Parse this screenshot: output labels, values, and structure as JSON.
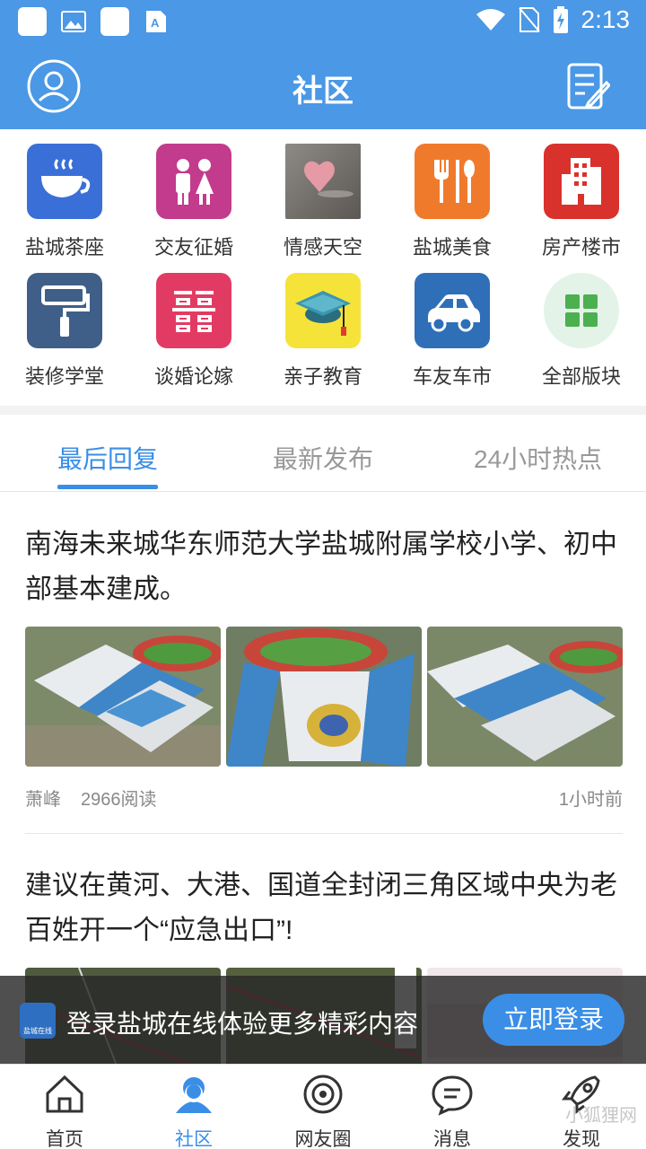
{
  "status_bar": {
    "time": "2:13"
  },
  "header": {
    "title": "社区"
  },
  "categories": [
    {
      "label": "盐城茶座",
      "icon": "tea-cup-icon"
    },
    {
      "label": "交友征婚",
      "icon": "couple-icon"
    },
    {
      "label": "情感天空",
      "icon": "heart-photo-icon"
    },
    {
      "label": "盐城美食",
      "icon": "cutlery-icon"
    },
    {
      "label": "房产楼市",
      "icon": "building-icon"
    },
    {
      "label": "装修学堂",
      "icon": "paint-roller-icon"
    },
    {
      "label": "谈婚论嫁",
      "icon": "double-happiness-icon"
    },
    {
      "label": "亲子教育",
      "icon": "graduation-cap-icon"
    },
    {
      "label": "车友车市",
      "icon": "car-icon"
    },
    {
      "label": "全部版块",
      "icon": "grid-icon"
    }
  ],
  "tabs": [
    {
      "label": "最后回复",
      "active": true
    },
    {
      "label": "最新发布",
      "active": false
    },
    {
      "label": "24小时热点",
      "active": false
    }
  ],
  "posts": [
    {
      "title": "南海未来城华东师范大学盐城附属学校小学、初中部基本建成。",
      "author": "萧峰",
      "reads": "2966阅读",
      "time": "1小时前"
    },
    {
      "title": "建议在黄河、大港、国道全封闭三角区域中央为老百姓开一个“应急出口”!"
    }
  ],
  "login_banner": {
    "logo_text": "盐城在线",
    "text": "登录盐城在线体验更多精彩内容",
    "button": "立即登录"
  },
  "bottom_nav": [
    {
      "label": "首页",
      "icon": "home-icon"
    },
    {
      "label": "社区",
      "icon": "community-icon",
      "active": true
    },
    {
      "label": "网友圈",
      "icon": "circle-icon"
    },
    {
      "label": "消息",
      "icon": "message-icon"
    },
    {
      "label": "发现",
      "icon": "rocket-icon"
    }
  ],
  "watermark": "小狐狸网",
  "colors": {
    "primary": "#4a98e6",
    "accent": "#3a8ee6"
  }
}
